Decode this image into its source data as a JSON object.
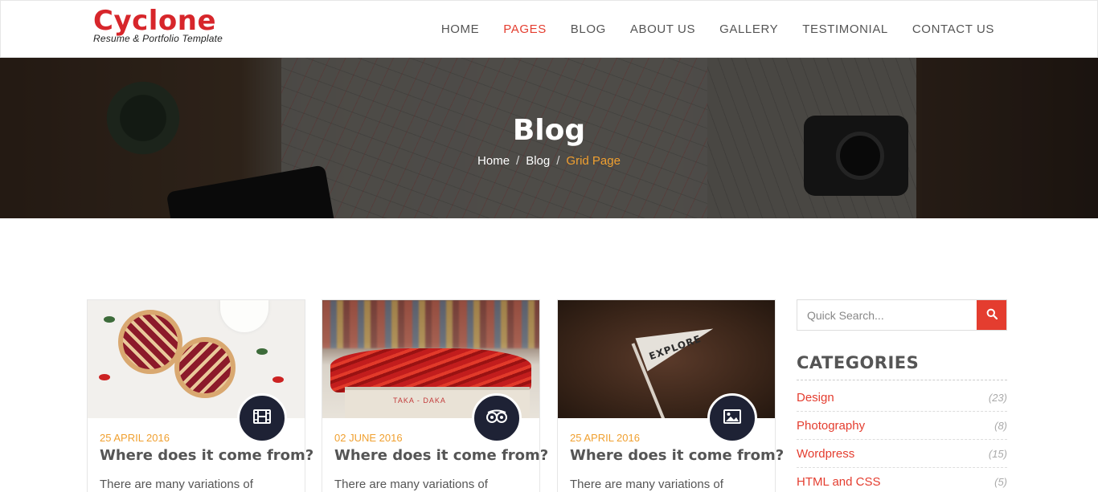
{
  "brand": {
    "title": "Cyclone",
    "tagline": "Resume & Portfolio Template"
  },
  "nav": {
    "items": [
      {
        "label": "HOME",
        "active": false
      },
      {
        "label": "PAGES",
        "active": true
      },
      {
        "label": "BLOG",
        "active": false
      },
      {
        "label": "ABOUT US",
        "active": false
      },
      {
        "label": "GALLERY",
        "active": false
      },
      {
        "label": "TESTIMONIAL",
        "active": false
      },
      {
        "label": "CONTACT US",
        "active": false
      }
    ]
  },
  "banner": {
    "title": "Blog",
    "breadcrumb": {
      "home": "Home",
      "section": "Blog",
      "current": "Grid Page",
      "separator": "/"
    }
  },
  "posts": [
    {
      "date": "25 APRIL 2016",
      "title": "Where does it come from?",
      "excerpt": "There are many variations of",
      "icon": "film-icon",
      "image": "pie-photo"
    },
    {
      "date": "02 JUNE 2016",
      "title": "Where does it come from?",
      "excerpt": "There are many variations of",
      "icon": "tripadvisor-icon",
      "image": "chili-peppers-photo",
      "image_text": "TAKA  -  DAKA"
    },
    {
      "date": "25 APRIL 2016",
      "title": "Where does it come from?",
      "excerpt": "There are many variations of",
      "icon": "image-icon",
      "image": "explore-flag-photo",
      "image_text": "EXPLORE"
    }
  ],
  "sidebar": {
    "search": {
      "placeholder": "Quick Search..."
    },
    "categories": {
      "title": "CATEGORIES",
      "items": [
        {
          "name": "Design",
          "count": "(23)"
        },
        {
          "name": "Photography",
          "count": "(8)"
        },
        {
          "name": "Wordpress",
          "count": "(15)"
        },
        {
          "name": "HTML and CSS",
          "count": "(5)"
        }
      ]
    }
  },
  "colors": {
    "accent": "#e43d2f",
    "brand": "#d7262b",
    "date": "#f0a030",
    "badge": "#1e2235"
  }
}
